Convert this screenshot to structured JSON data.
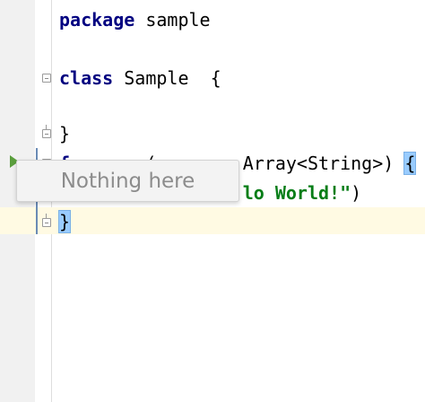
{
  "editor": {
    "lines": [
      {
        "keyword": "package",
        "rest": " sample"
      },
      {
        "keyword": "class",
        "rest": " Sample  {"
      },
      {
        "text": "}"
      },
      {
        "pre": "  ",
        "keyword": "f",
        "partial": "       (        Array<String>) ",
        "brace": "{"
      },
      {
        "partial": "                 ",
        "string": "lo World!\"",
        "tail": ")"
      },
      {
        "brace": "}"
      }
    ]
  },
  "popup": {
    "message": "Nothing here"
  },
  "colors": {
    "keyword": "#000080",
    "string": "#067d17",
    "brace_highlight": "#99ccff",
    "current_line": "#fffae3",
    "run_icon": "#5a9e3d"
  },
  "icons": {
    "run": "run-gutter-icon",
    "fold": "fold-marker-icon"
  }
}
